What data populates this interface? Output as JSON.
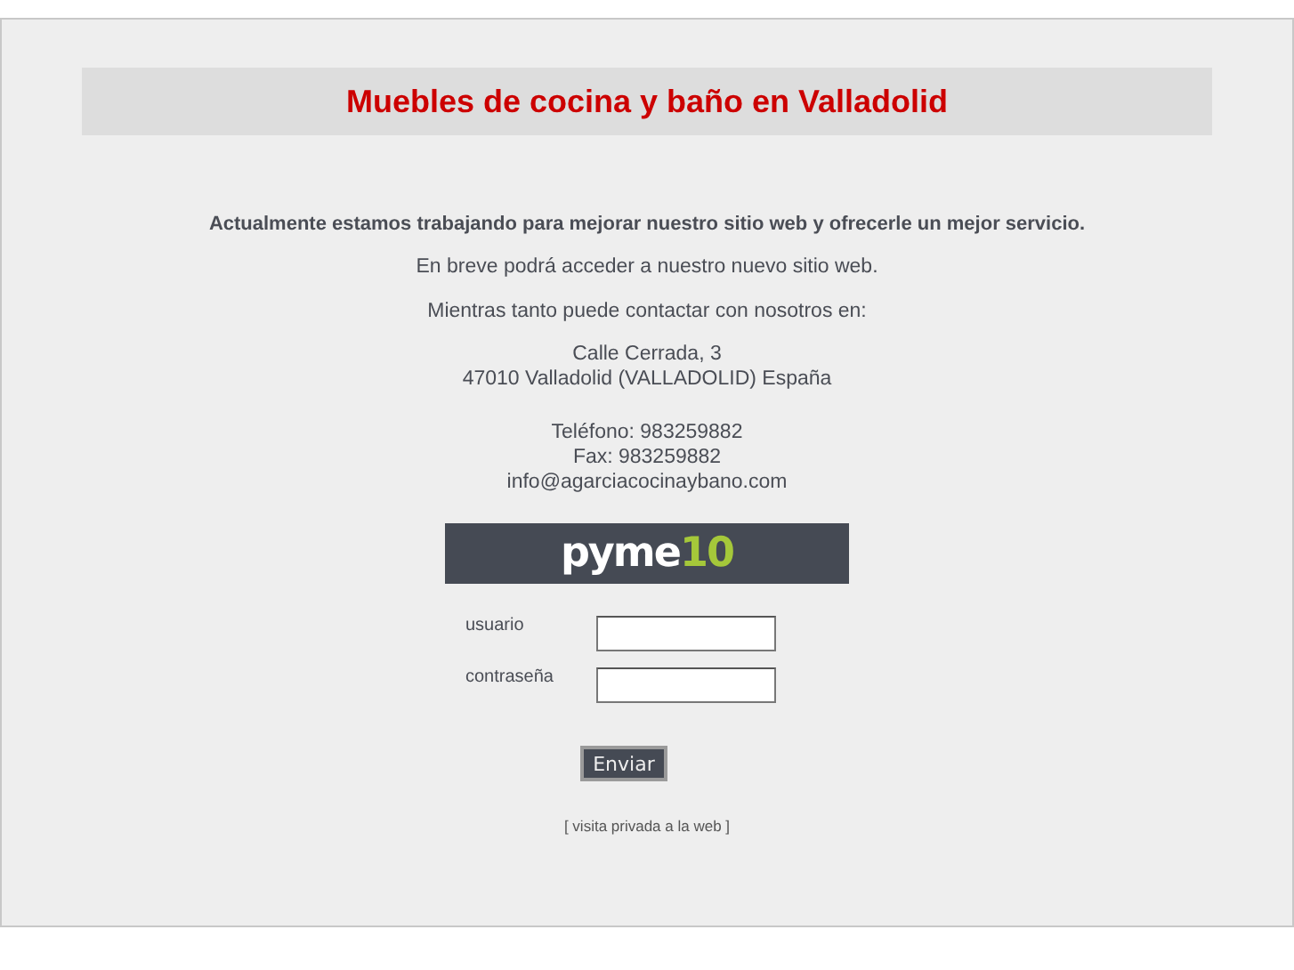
{
  "header": {
    "title": "Muebles de cocina y baño en Valladolid"
  },
  "notice": "Actualmente estamos trabajando para mejorar nuestro sitio web y ofrecerle un mejor servicio.",
  "paragraphs": [
    "En breve podrá acceder a nuestro nuevo sitio web.",
    "Mientras tanto puede contactar con nosotros en:"
  ],
  "address": [
    "Calle Cerrada, 3",
    "47010 Valladolid (VALLADOLID) España"
  ],
  "contact": [
    "Teléfono: 983259882",
    "Fax: 983259882",
    "info@agarciacocinaybano.com"
  ],
  "logo": {
    "text": "pyme",
    "accent": "10"
  },
  "login": {
    "fields": [
      {
        "label": "usuario"
      },
      {
        "label": "contraseña"
      }
    ],
    "submit": "Enviar"
  },
  "private_link": "[ visita privada a la web ]"
}
